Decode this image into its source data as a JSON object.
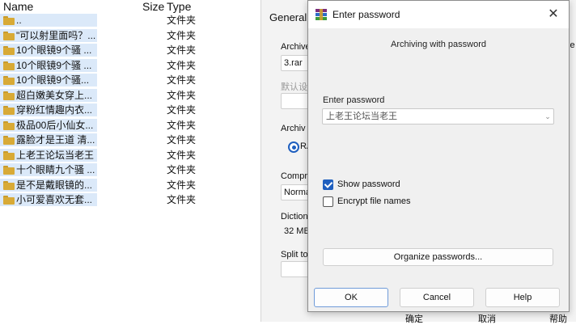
{
  "filelist": {
    "headers": {
      "name": "Name",
      "size": "Size",
      "type": "Type"
    },
    "rows": [
      {
        "name": "..",
        "type": "文件夹"
      },
      {
        "name": "\"可以射里面吗？...",
        "type": "文件夹"
      },
      {
        "name": "10个眼镜9个骚 ...",
        "type": "文件夹"
      },
      {
        "name": "10个眼镜9个骚 ...",
        "type": "文件夹"
      },
      {
        "name": "10个眼镜9个骚...",
        "type": "文件夹"
      },
      {
        "name": "超白嫩美女穿上...",
        "type": "文件夹"
      },
      {
        "name": "穿粉红情趣内衣...",
        "type": "文件夹"
      },
      {
        "name": "极品00后小仙女...",
        "type": "文件夹"
      },
      {
        "name": "露脸才是王道 清...",
        "type": "文件夹"
      },
      {
        "name": "上老王论坛当老王",
        "type": "文件夹"
      },
      {
        "name": "十个眼睛九个骚 ...",
        "type": "文件夹"
      },
      {
        "name": "是不是戴眼镜的...",
        "type": "文件夹"
      },
      {
        "name": "小可爱喜欢无套...",
        "type": "文件夹"
      }
    ]
  },
  "archive_dialog": {
    "tab_general": "General",
    "archive_label": "Archive",
    "archive_value": "3.rar",
    "default_label": "默认设",
    "archive_format_label": "Archiv",
    "radio_label": "RA",
    "compression_label": "Compre",
    "compression_value": "Norma",
    "dictionary_label": "Dictiona",
    "dictionary_value": "32 MB",
    "split_label": "Split to",
    "right_cut": "se",
    "bottom_buttons": [
      "确定",
      "取消",
      "帮助"
    ]
  },
  "password_dialog": {
    "title": "Enter password",
    "heading": "Archiving with password",
    "field_label": "Enter password",
    "password_value": "上老王论坛当老王",
    "show_password": {
      "label": "Show password",
      "checked": true
    },
    "encrypt_names": {
      "label": "Encrypt file names",
      "checked": false
    },
    "organize_label": "Organize passwords...",
    "ok_label": "OK",
    "cancel_label": "Cancel",
    "help_label": "Help",
    "close_glyph": "✕"
  }
}
